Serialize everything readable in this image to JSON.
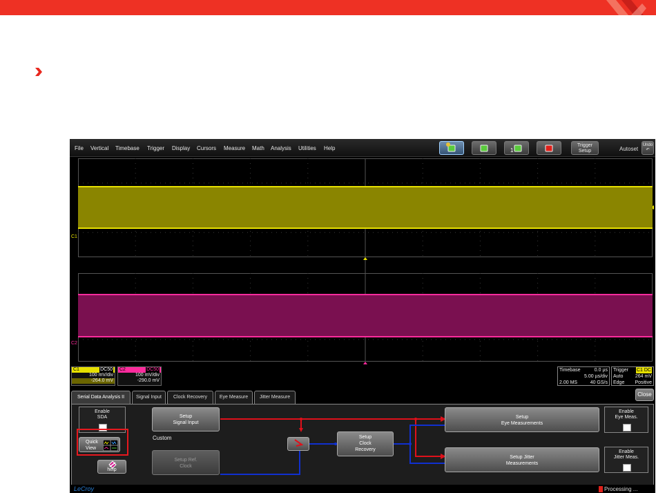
{
  "menu": [
    "File",
    "Vertical",
    "Timebase",
    "Trigger",
    "Display",
    "Cursors",
    "Measure",
    "Math",
    "Analysis",
    "Utilities",
    "Help"
  ],
  "toolbar": {
    "trigger_setup_line1": "Trigger",
    "trigger_setup_line2": "Setup",
    "autoset": "Autoset",
    "undo_line1": "Undo",
    "undo_line2": "↶"
  },
  "channels": {
    "c1": {
      "label": "C1",
      "coupling": "DC50",
      "vdiv": "100 mV/div",
      "offset": "-264.0 mV",
      "color": "#e6e000"
    },
    "c2": {
      "label": "C2",
      "coupling": "DC50",
      "vdiv": "100 mV/div",
      "offset": "-290.0 mV",
      "color": "#ff2b9d"
    }
  },
  "timebase": {
    "title": "Timebase",
    "delay": "0.0 µs",
    "tdiv": "5.00 µs/div",
    "samples": "2.00 MS",
    "rate": "40 GS/s"
  },
  "trigger": {
    "title": "Trigger",
    "src": "C1 DC",
    "mode": "Auto",
    "level": "264 mV",
    "type": "Edge",
    "slope": "Positive"
  },
  "tabs": [
    "Serial Data Analysis II",
    "Signal Input",
    "Clock Recovery",
    "Eye Measure",
    "Jitter Measure"
  ],
  "close": "Close",
  "panel": {
    "enable_sda_1": "Enable",
    "enable_sda_2": "SDA",
    "quick_view_1": "Quick",
    "quick_view_2": "View",
    "help": "help",
    "setup_signal_1": "Setup",
    "setup_signal_2": "Signal Input",
    "custom": "Custom",
    "setup_ref_1": "Setup Ref.",
    "setup_ref_2": "Clock",
    "setup_clock_1": "Setup",
    "setup_clock_2": "Clock",
    "setup_clock_3": "Recovery",
    "setup_eye_1": "Setup",
    "setup_eye_2": "Eye Measurements",
    "setup_jitter_1": "Setup Jitter",
    "setup_jitter_2": "Measurements",
    "enable_eye_1": "Enable",
    "enable_eye_2": "Eye Meas.",
    "enable_jitter_1": "Enable",
    "enable_jitter_2": "Jitter Meas."
  },
  "brand": "LeCroy",
  "status": "Processing ...",
  "colors": {
    "banner": "#ee3124",
    "signal_wire": "#e0101a",
    "clock_wire": "#1030d0",
    "highlight": "#e8181e"
  }
}
